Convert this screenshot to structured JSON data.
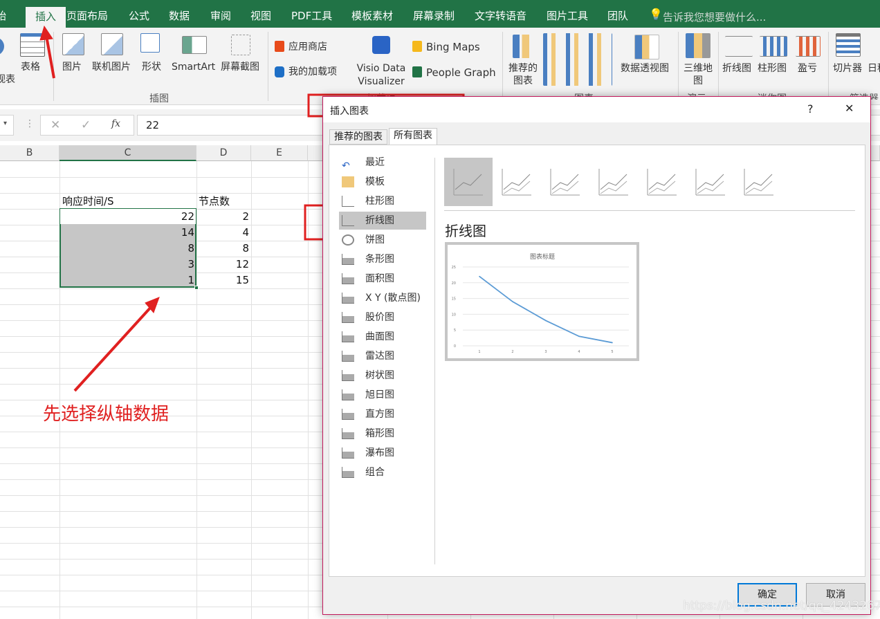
{
  "ribbon_tabs": [
    "始",
    "插入",
    "页面布局",
    "公式",
    "数据",
    "审阅",
    "视图",
    "PDF工具",
    "模板素材",
    "屏幕录制",
    "文字转语音",
    "图片工具",
    "团队"
  ],
  "tell_me": "告诉我您想要做什么...",
  "ribbon": {
    "pivot_partial": "加视表",
    "table": "表格",
    "picture": "图片",
    "online_picture": "联机图片",
    "shapes": "形状",
    "smartart": "SmartArt",
    "screenshot": "屏幕截图",
    "group_illustrations": "插图",
    "store": "应用商店",
    "my_addins": "我的加载项",
    "visio": "Visio Data Visualizer",
    "bing": "Bing Maps",
    "people": "People Graph",
    "group_addins": "加载项",
    "recommended_charts": "推荐的图表",
    "pivot_chart": "数据透视图",
    "group_charts": "图表",
    "map3d": "三维地图",
    "group_tours": "演示",
    "spark_line": "折线图",
    "spark_column": "柱形图",
    "spark_winloss": "盈亏",
    "group_sparklines": "迷你图",
    "slicer": "切片器",
    "timeline": "日程",
    "group_filters": "筛选器"
  },
  "formula_bar": {
    "value": "22",
    "fx": "fx"
  },
  "columns": [
    "B",
    "C",
    "D",
    "E"
  ],
  "sheet": {
    "header_c": "响应时间/S",
    "header_d": "节点数",
    "c": [
      "22",
      "14",
      "8",
      "3",
      "1"
    ],
    "d": [
      "2",
      "4",
      "8",
      "12",
      "15"
    ]
  },
  "annotation": "先选择纵轴数据",
  "dialog": {
    "title": "插入图表",
    "help": "?",
    "close": "✕",
    "tabs": [
      "推荐的图表",
      "所有图表"
    ],
    "categories": [
      "最近",
      "模板",
      "柱形图",
      "折线图",
      "饼图",
      "条形图",
      "面积图",
      "X Y (散点图)",
      "股价图",
      "曲面图",
      "雷达图",
      "树状图",
      "旭日图",
      "直方图",
      "箱形图",
      "瀑布图",
      "组合"
    ],
    "selected_category": "折线图",
    "section_title": "折线图",
    "ok": "确定",
    "cancel": "取消"
  },
  "chart_data": {
    "type": "line",
    "title": "图表标题",
    "categories": [
      "1",
      "2",
      "3",
      "4",
      "5"
    ],
    "values": [
      22,
      14,
      8,
      3,
      1
    ],
    "ylim": [
      0,
      25
    ],
    "yticks": [
      0,
      5,
      10,
      15,
      20,
      25
    ],
    "grid": true,
    "color": "#5b9bd5"
  },
  "watermark": "https://blog.csdn.net/qq_42432673",
  "colors": {
    "excel_green": "#217346",
    "annotation_red": "#e02020",
    "selection_gray": "#c6c6c6"
  }
}
